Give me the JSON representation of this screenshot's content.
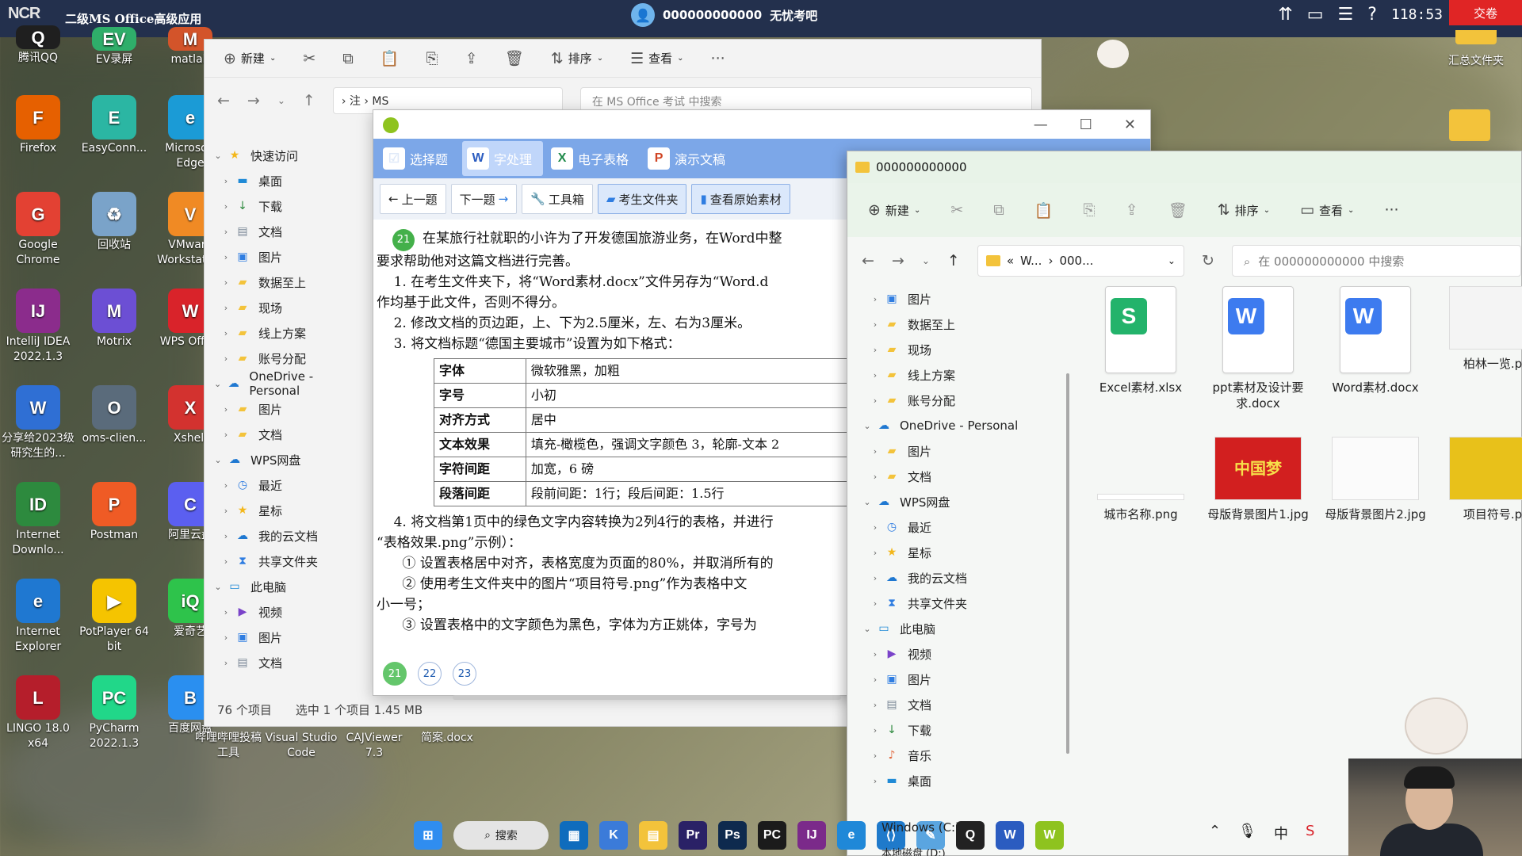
{
  "exam_bar": {
    "logo": "NCR",
    "title": "二级MS Office高级应用",
    "candidate_id": "000000000000",
    "exam_name": "无忧考吧",
    "time": "118:53",
    "submit_label": "交卷"
  },
  "desktop": {
    "icons": [
      {
        "label": "腾讯QQ",
        "color": "#1f1f1f",
        "glyph": "Q"
      },
      {
        "label": "EV录屏",
        "color": "#2fae6a",
        "glyph": "EV"
      },
      {
        "label": "matlab",
        "color": "#d3542a",
        "glyph": "M"
      },
      {
        "label": "Firefox",
        "color": "#e66000",
        "glyph": "F"
      },
      {
        "label": "EasyConn...",
        "color": "#2bb6a3",
        "glyph": "E"
      },
      {
        "label": "Microsoft Edge",
        "color": "#1b9bd6",
        "glyph": "e"
      },
      {
        "label": "Google Chrome",
        "color": "#e34133",
        "glyph": "G"
      },
      {
        "label": "回收站",
        "color": "#7aa3c9",
        "glyph": "♻"
      },
      {
        "label": "VMware Workstation",
        "color": "#f08a24",
        "glyph": "V"
      },
      {
        "label": "IntelliJ IDEA 2022.1.3",
        "color": "#8b2c8c",
        "glyph": "IJ"
      },
      {
        "label": "Motrix",
        "color": "#6c4fd4",
        "glyph": "M"
      },
      {
        "label": "WPS Office",
        "color": "#d9232a",
        "glyph": "W"
      },
      {
        "label": "分享给2023级研究生的...",
        "color": "#2f6fd4",
        "glyph": "W"
      },
      {
        "label": "oms-clien...",
        "color": "#5a6b7b",
        "glyph": "O"
      },
      {
        "label": "Xshell",
        "color": "#d3322f",
        "glyph": "X"
      },
      {
        "label": "Internet Downlo...",
        "color": "#2d8a3e",
        "glyph": "ID"
      },
      {
        "label": "Postman",
        "color": "#ef5b25",
        "glyph": "P"
      },
      {
        "label": "阿里云盘",
        "color": "#5b5ff0",
        "glyph": "C"
      },
      {
        "label": "Internet Explorer",
        "color": "#1f78d1",
        "glyph": "e"
      },
      {
        "label": "PotPlayer 64 bit",
        "color": "#f5c400",
        "glyph": "▶"
      },
      {
        "label": "爱奇艺",
        "color": "#2ec34b",
        "glyph": "iQ"
      },
      {
        "label": "LINGO 18.0 x64",
        "color": "#b51e2b",
        "glyph": "L"
      },
      {
        "label": "PyCharm 2022.1.3",
        "color": "#21d789",
        "glyph": "PC"
      },
      {
        "label": "百度网盘",
        "color": "#2a8ff0",
        "glyph": "B"
      },
      {
        "label": "哔哩哔哩投稿工具",
        "color": "#2a2a2a",
        "glyph": ""
      },
      {
        "label": "Visual Studio Code",
        "color": "#2a2a2a",
        "glyph": ""
      },
      {
        "label": "CAJViewer 7.3",
        "color": "#2a2a2a",
        "glyph": ""
      },
      {
        "label": "简案.docx",
        "color": "#2a2a2a",
        "glyph": ""
      }
    ],
    "right_label": "汇总文件夹"
  },
  "explorer_bg": {
    "toolbar": [
      "新建",
      "排序",
      "查看"
    ],
    "address": "› 注 › MS",
    "search_placeholder": "在 MS Office 考试 中搜索",
    "sidebar": [
      {
        "label": "快速访问",
        "level": 0,
        "icon": "star"
      },
      {
        "label": "桌面",
        "level": 1,
        "icon": "desktop"
      },
      {
        "label": "下载",
        "level": 1,
        "icon": "download"
      },
      {
        "label": "文档",
        "level": 1,
        "icon": "document"
      },
      {
        "label": "图片",
        "level": 1,
        "icon": "picture"
      },
      {
        "label": "数据至上",
        "level": 1,
        "icon": "folder"
      },
      {
        "label": "现场",
        "level": 1,
        "icon": "folder"
      },
      {
        "label": "线上方案",
        "level": 1,
        "icon": "folder"
      },
      {
        "label": "账号分配",
        "level": 1,
        "icon": "folder"
      },
      {
        "label": "OneDrive - Personal",
        "level": 0,
        "icon": "cloud"
      },
      {
        "label": "图片",
        "level": 1,
        "icon": "folder"
      },
      {
        "label": "文档",
        "level": 1,
        "icon": "folder"
      },
      {
        "label": "WPS网盘",
        "level": 0,
        "icon": "cloud"
      },
      {
        "label": "最近",
        "level": 1,
        "icon": "clock"
      },
      {
        "label": "星标",
        "level": 1,
        "icon": "star"
      },
      {
        "label": "我的云文档",
        "level": 1,
        "icon": "cloud"
      },
      {
        "label": "共享文件夹",
        "level": 1,
        "icon": "share"
      },
      {
        "label": "此电脑",
        "level": 0,
        "icon": "pc"
      },
      {
        "label": "视频",
        "level": 1,
        "icon": "video"
      },
      {
        "label": "图片",
        "level": 1,
        "icon": "picture"
      },
      {
        "label": "文档",
        "level": 1,
        "icon": "document"
      }
    ],
    "status_count": "76 个项目",
    "status_selected": "选中 1 个项目  1.45 MB"
  },
  "question_window": {
    "tabs": [
      {
        "label": "选择题",
        "glyph": "☑",
        "color": "#dfe9f8"
      },
      {
        "label": "字处理",
        "glyph": "W",
        "color": "#2b5cc0"
      },
      {
        "label": "电子表格",
        "glyph": "X",
        "color": "#1f8a4a"
      },
      {
        "label": "演示文稿",
        "glyph": "P",
        "color": "#d04423"
      }
    ],
    "tools": [
      "上一题",
      "下一题",
      "工具箱",
      "考生文件夹",
      "查看原始素材"
    ],
    "question_number": "21",
    "paragraphs": [
      "在某旅行社就职的小许为了开发德国旅游业务，在Word中整",
      "要求帮助他对这篇文档进行完善。",
      "    1. 在考生文件夹下，将“Word素材.docx”文件另存为“Word.d",
      "作均基于此文件，否则不得分。",
      "    2. 修改文档的页边距，上、下为2.5厘米，左、右为3厘米。",
      "    3. 将文档标题“德国主要城市”设置为如下格式："
    ],
    "format_table": [
      [
        "字体",
        "微软雅黑，加粗"
      ],
      [
        "字号",
        "小初"
      ],
      [
        "对齐方式",
        "居中"
      ],
      [
        "文本效果",
        "填充-橄榄色，强调文字颜色 3，轮廓-文本 2"
      ],
      [
        "字符间距",
        "加宽，6 磅"
      ],
      [
        "段落间距",
        "段前间距：1行；段后间距：1.5行"
      ]
    ],
    "paragraphs_after": [
      "    4. 将文档第1页中的绿色文字内容转换为2列4行的表格，并进行",
      "“表格效果.png”示例）：",
      "      ① 设置表格居中对齐，表格宽度为页面的80%，并取消所有的",
      "      ② 使用考生文件夹中的图片“项目符号.png”作为表格中文",
      "小一号；",
      "      ③ 设置表格中的文字颜色为黑色，字体为方正姚体，字号为"
    ],
    "pages": [
      "21",
      "22",
      "23"
    ],
    "current_page": "21"
  },
  "explorer_fg": {
    "title": "000000000000",
    "toolbar": [
      "新建",
      "排序",
      "查看"
    ],
    "address_parts": [
      "«",
      "W...",
      "›",
      "000..."
    ],
    "search_placeholder": "在 000000000000 中搜索",
    "sidebar": [
      {
        "label": "图片",
        "level": 1,
        "icon": "picture"
      },
      {
        "label": "数据至上",
        "level": 1,
        "icon": "folder"
      },
      {
        "label": "现场",
        "level": 1,
        "icon": "folder"
      },
      {
        "label": "线上方案",
        "level": 1,
        "icon": "folder"
      },
      {
        "label": "账号分配",
        "level": 1,
        "icon": "folder"
      },
      {
        "label": "OneDrive - Personal",
        "level": 0,
        "icon": "cloud"
      },
      {
        "label": "图片",
        "level": 1,
        "icon": "folder"
      },
      {
        "label": "文档",
        "level": 1,
        "icon": "folder"
      },
      {
        "label": "WPS网盘",
        "level": 0,
        "icon": "cloud"
      },
      {
        "label": "最近",
        "level": 1,
        "icon": "clock"
      },
      {
        "label": "星标",
        "level": 1,
        "icon": "star"
      },
      {
        "label": "我的云文档",
        "level": 1,
        "icon": "cloud"
      },
      {
        "label": "共享文件夹",
        "level": 1,
        "icon": "share"
      },
      {
        "label": "此电脑",
        "level": 0,
        "icon": "pc"
      },
      {
        "label": "视频",
        "level": 1,
        "icon": "video"
      },
      {
        "label": "图片",
        "level": 1,
        "icon": "picture"
      },
      {
        "label": "文档",
        "level": 1,
        "icon": "document"
      },
      {
        "label": "下载",
        "level": 1,
        "icon": "download"
      },
      {
        "label": "音乐",
        "level": 1,
        "icon": "music"
      },
      {
        "label": "桌面",
        "level": 1,
        "icon": "desktop"
      }
    ],
    "files": [
      {
        "label": "Excel素材.xlsx",
        "kind": "doc",
        "badge": "S",
        "color": "#23b36b"
      },
      {
        "label": "ppt素材及设计要求.docx",
        "kind": "doc",
        "badge": "W",
        "color": "#3d7bef"
      },
      {
        "label": "Word素材.docx",
        "kind": "doc",
        "badge": "W",
        "color": "#3d7bef"
      },
      {
        "label": "柏林一览.p",
        "kind": "img",
        "badge": "",
        "color": "#f4f4f4"
      },
      {
        "label": "城市名称.png",
        "kind": "img",
        "badge": "",
        "color": "#ffffff"
      },
      {
        "label": "母版背景图片1.jpg",
        "kind": "img",
        "badge": "中国梦",
        "color": "#d21f1f"
      },
      {
        "label": "母版背景图片2.jpg",
        "kind": "img",
        "badge": "",
        "color": "#fbfbfb"
      },
      {
        "label": "项目符号.p",
        "kind": "img",
        "badge": "",
        "color": "#e8c11a"
      }
    ]
  },
  "taskbar": {
    "search_label": "搜索",
    "apps": [
      {
        "name": "start",
        "color": "#2f8df0",
        "glyph": "⊞"
      },
      {
        "name": "store",
        "color": "#0f6cbd",
        "glyph": "▦"
      },
      {
        "name": "k-app",
        "color": "#3b7bd9",
        "glyph": "K"
      },
      {
        "name": "file-explorer",
        "color": "#f3c33b",
        "glyph": "▤"
      },
      {
        "name": "premiere",
        "color": "#2a2166",
        "glyph": "Pr"
      },
      {
        "name": "photoshop",
        "color": "#0e2a4e",
        "glyph": "Ps"
      },
      {
        "name": "pycharm",
        "color": "#1b1b1b",
        "glyph": "PC"
      },
      {
        "name": "intellij",
        "color": "#7b2a8a",
        "glyph": "IJ"
      },
      {
        "name": "edge",
        "color": "#1f88d8",
        "glyph": "e"
      },
      {
        "name": "vscode",
        "color": "#1f7acb",
        "glyph": "⟨⟩"
      },
      {
        "name": "sketch",
        "color": "#5aa5e0",
        "glyph": "✎"
      },
      {
        "name": "qq",
        "color": "#222222",
        "glyph": "Q"
      },
      {
        "name": "word",
        "color": "#2b5cc0",
        "glyph": "W"
      },
      {
        "name": "exam",
        "color": "#8ec31f",
        "glyph": "W"
      }
    ],
    "drive_label": "Windows (C:)",
    "drive_label2": "本地磁盘 (D:)"
  }
}
